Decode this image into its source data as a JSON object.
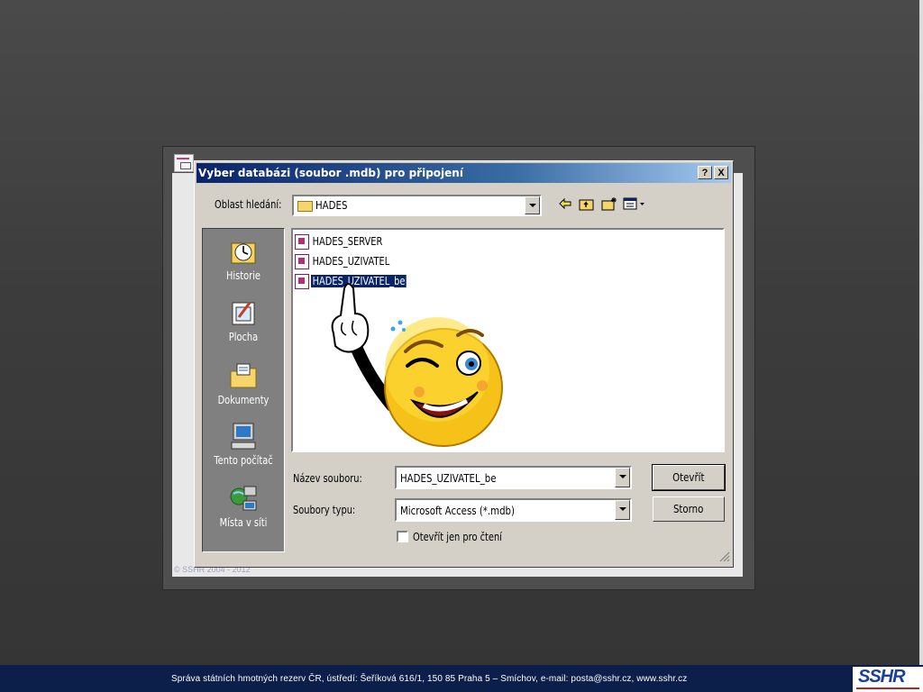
{
  "dialog": {
    "title": "Vyber databázi (soubor .mdb) pro připojení",
    "help_label": "?",
    "close_label": "X"
  },
  "look_in": {
    "label": "Oblast hledání:",
    "value": "HADES"
  },
  "toolbar": {
    "back_icon": "arrow-left-icon",
    "up_icon": "folder-up-icon",
    "new_folder_icon": "new-folder-icon",
    "views_icon": "views-menu-icon"
  },
  "places": [
    {
      "label": "Historie",
      "icon": "history-icon"
    },
    {
      "label": "Plocha",
      "icon": "desktop-icon"
    },
    {
      "label": "Dokumenty",
      "icon": "documents-folder-icon"
    },
    {
      "label": "Tento počítač",
      "icon": "computer-icon"
    },
    {
      "label": "Místa v síti",
      "icon": "network-icon"
    }
  ],
  "files": [
    {
      "name": "HADES_SERVER",
      "selected": false
    },
    {
      "name": "HADES_UZIVATEL",
      "selected": false
    },
    {
      "name": "HADES_UZIVATEL_be",
      "selected": true
    }
  ],
  "filename": {
    "label": "Název souboru:",
    "value": "HADES_UZIVATEL_be"
  },
  "filetype": {
    "label": "Soubory typu:",
    "value": "Microsoft Access (*.mdb)"
  },
  "readonly": {
    "label": "Otevřít jen pro čtení",
    "checked": false
  },
  "buttons": {
    "open": "Otevřít",
    "cancel": "Storno"
  },
  "slide": {
    "copyright": "© SSHR 2004 - 2012",
    "footer": "Správa státních hmotných rezerv ČR, ústředí: Šeříková 616/1, 150 85 Praha 5 – Smíchov, e-mail: posta@sshr.cz, www.sshr.cz",
    "logo": "SSHR"
  },
  "colors": {
    "title_bar": "#0a246a",
    "footer_bg": "#0b1f4a",
    "dialog_face": "#d4d0c8"
  }
}
